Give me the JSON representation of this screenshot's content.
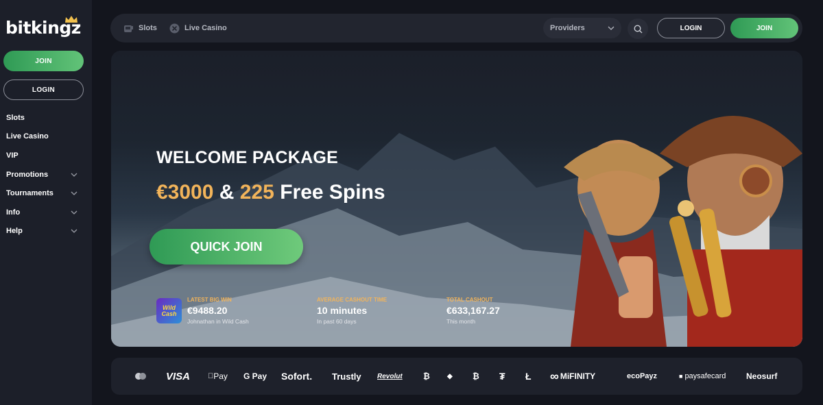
{
  "brand": {
    "logo_text": "bitkingz"
  },
  "sidebar": {
    "join_label": "JOIN",
    "login_label": "LOGIN",
    "items": [
      {
        "label": "Slots",
        "has_chevron": false
      },
      {
        "label": "Live Casino",
        "has_chevron": false
      },
      {
        "label": "VIP",
        "has_chevron": false
      },
      {
        "label": "Promotions",
        "has_chevron": true
      },
      {
        "label": "Tournaments",
        "has_chevron": true
      },
      {
        "label": "Info",
        "has_chevron": true
      },
      {
        "label": "Help",
        "has_chevron": true
      }
    ]
  },
  "topbar": {
    "nav": [
      {
        "label": "Slots",
        "icon": "slot-machine-icon"
      },
      {
        "label": "Live Casino",
        "icon": "chip-icon"
      }
    ],
    "providers_label": "Providers",
    "login_label": "LOGIN",
    "join_label": "JOIN"
  },
  "hero": {
    "title": "WELCOME PACKAGE",
    "offer_amount": "€3000",
    "offer_and": "&",
    "offer_spins_count": "225",
    "offer_spins_text": "Free Spins",
    "cta_label": "QUICK JOIN",
    "stats": {
      "big_win": {
        "label": "LATEST BIG WIN",
        "value": "€9488.20",
        "sub": "Johnathan in Wild Cash",
        "thumb_text": "Wild Cash"
      },
      "cashout_time": {
        "label": "AVERAGE CASHOUT TIME",
        "value": "10 minutes",
        "sub": "In past 60 days"
      },
      "total_cashout": {
        "label": "TOTAL CASHOUT",
        "value": "€633,167.27",
        "sub": "This month"
      }
    }
  },
  "payments": {
    "methods": [
      "VISA",
      "Pay",
      "G Pay",
      "Sofort.",
      "Trustly",
      "Revolut",
      "MiFINITY",
      "ecoPayz",
      "paysafecard",
      "Neosurf"
    ],
    "crypto_glyphs": [
      "₿",
      "◆",
      "₿",
      "₮",
      "Ł"
    ]
  },
  "colors": {
    "accent_green": "#3fae62",
    "gold": "#f2b45a",
    "bg": "#13151d",
    "panel": "#22252f"
  }
}
